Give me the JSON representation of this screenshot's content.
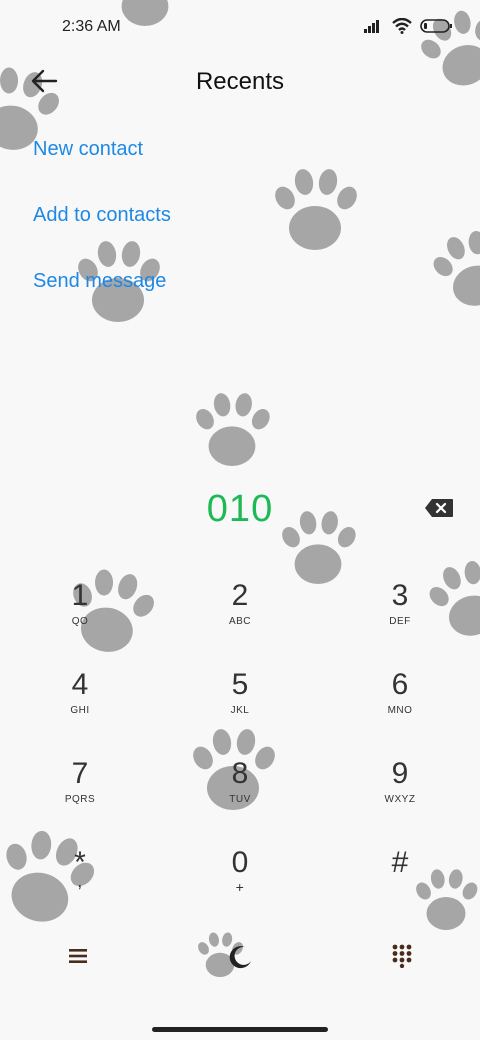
{
  "status_bar": {
    "time": "2:36 AM"
  },
  "header": {
    "title": "Recents"
  },
  "actions": {
    "new_contact": "New contact",
    "add_to_contacts": "Add to contacts",
    "send_message": "Send message"
  },
  "dialed_number": "010",
  "keypad": [
    {
      "digit": "1",
      "letters": "QO"
    },
    {
      "digit": "2",
      "letters": "ABC"
    },
    {
      "digit": "3",
      "letters": "DEF"
    },
    {
      "digit": "4",
      "letters": "GHI"
    },
    {
      "digit": "5",
      "letters": "JKL"
    },
    {
      "digit": "6",
      "letters": "MNO"
    },
    {
      "digit": "7",
      "letters": "PQRS"
    },
    {
      "digit": "8",
      "letters": "TUV"
    },
    {
      "digit": "9",
      "letters": "WXYZ"
    },
    {
      "digit": "*",
      "letters": ","
    },
    {
      "digit": "0",
      "letters": "+"
    },
    {
      "digit": "#",
      "letters": ""
    }
  ],
  "colors": {
    "accent": "#1e88e5",
    "number": "#1db954",
    "paw": "#9e9e9e"
  },
  "icons": [
    "back-arrow-icon",
    "backspace-icon",
    "menu-icon",
    "night-mode-icon",
    "dialpad-icon",
    "signal-icon",
    "wifi-icon",
    "battery-icon"
  ]
}
